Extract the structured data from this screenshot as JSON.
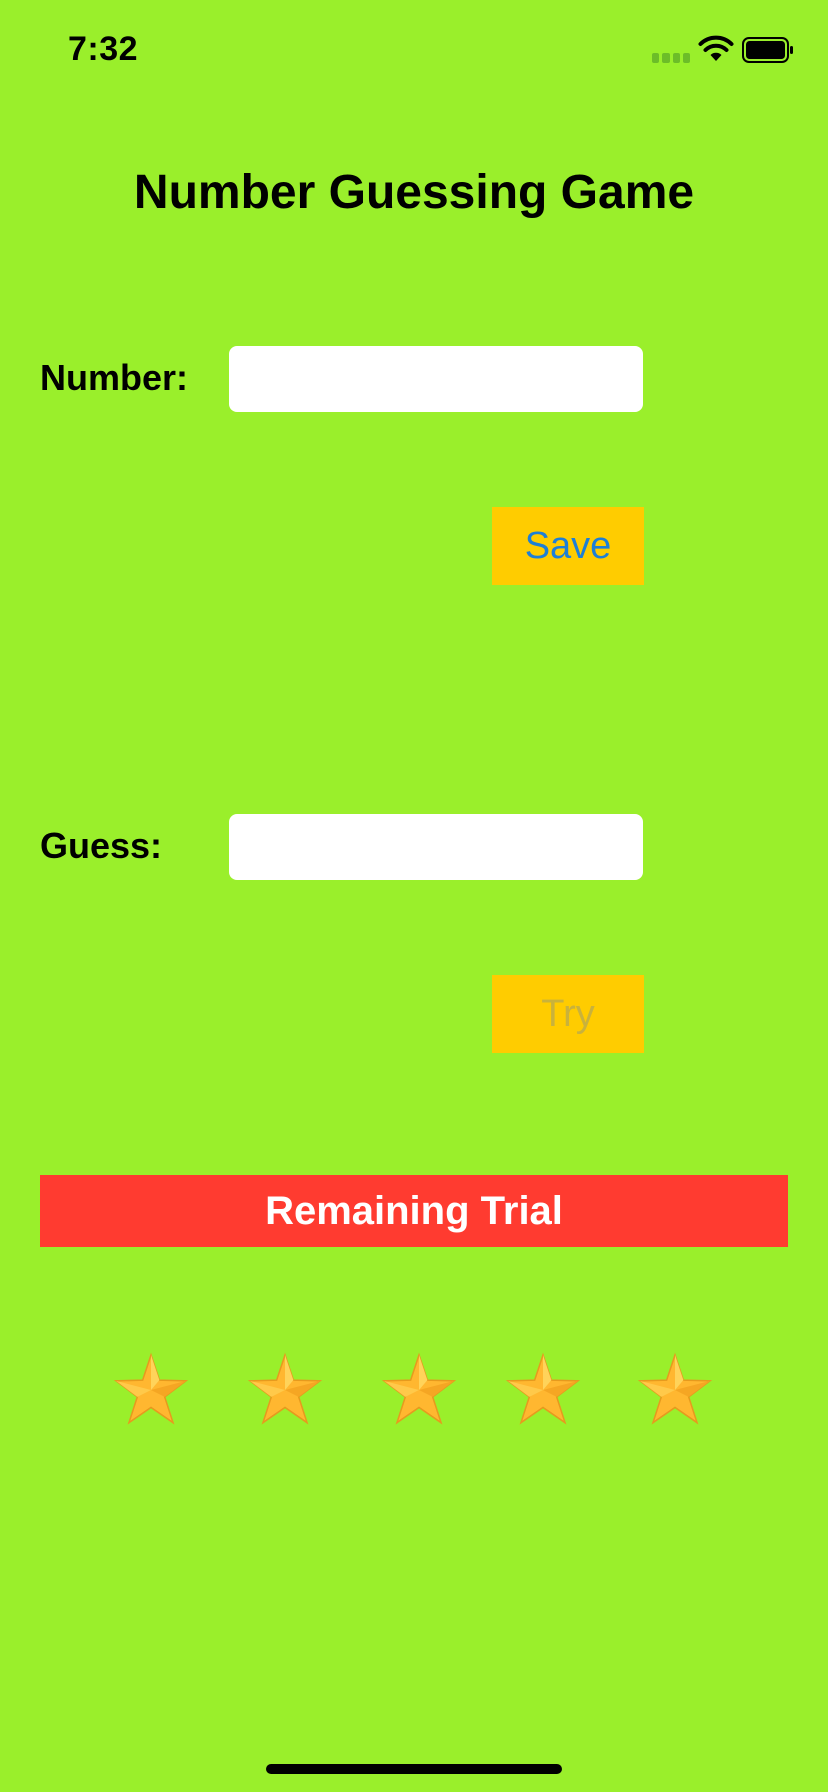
{
  "status_bar": {
    "time": "7:32",
    "icons": [
      "signal-icon",
      "wifi-icon",
      "battery-icon"
    ]
  },
  "screen": {
    "title": "Number Guessing Game",
    "number": {
      "label": "Number:",
      "value": "",
      "placeholder": ""
    },
    "save_button": {
      "label": "Save",
      "color": "#1E7FD6"
    },
    "guess": {
      "label": "Guess:",
      "value": "",
      "placeholder": ""
    },
    "try_button": {
      "label": "Try",
      "color": "#C9B23C"
    },
    "remaining_trial": {
      "label": "Remaining Trial",
      "stars_remaining": 5,
      "star_icon": "star-icon"
    }
  },
  "colors": {
    "background": "#9AEF2B",
    "button_background": "#FFCC00",
    "banner_background": "#FF3B30",
    "star": "#FFB730"
  }
}
